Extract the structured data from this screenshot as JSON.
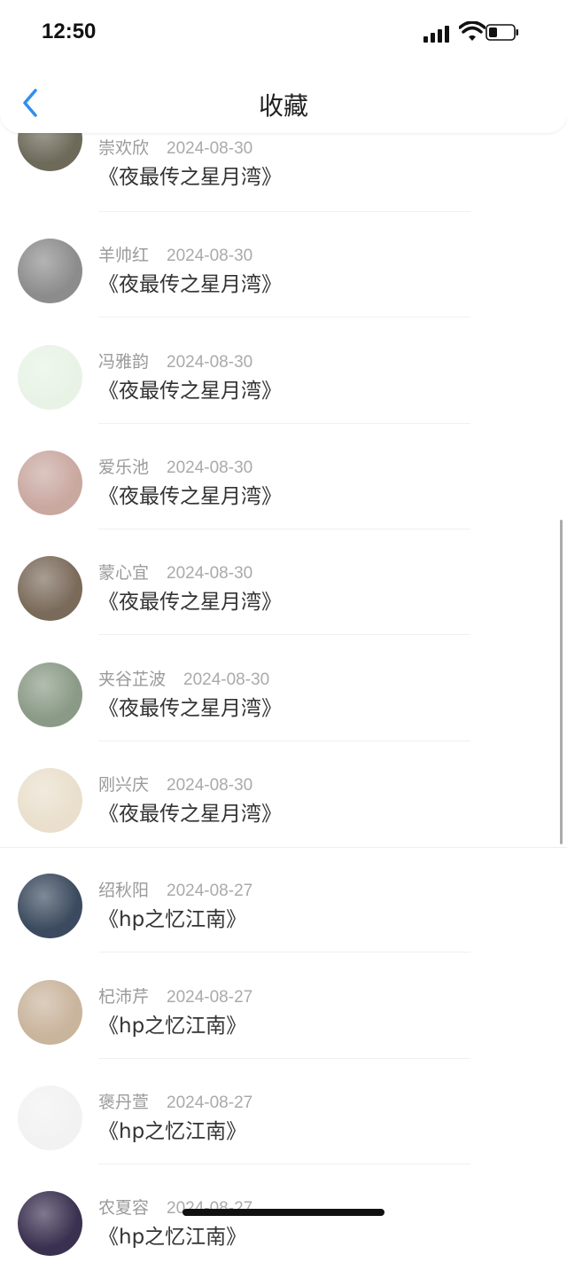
{
  "status_bar": {
    "time": "12:50"
  },
  "header": {
    "title": "收藏"
  },
  "items": [
    {
      "name": "崇欢欣",
      "date": "2024-08-30",
      "book": "《夜最传之星月湾》"
    },
    {
      "name": "羊帅红",
      "date": "2024-08-30",
      "book": "《夜最传之星月湾》"
    },
    {
      "name": "冯雅韵",
      "date": "2024-08-30",
      "book": "《夜最传之星月湾》"
    },
    {
      "name": "爱乐池",
      "date": "2024-08-30",
      "book": "《夜最传之星月湾》"
    },
    {
      "name": "蒙心宜",
      "date": "2024-08-30",
      "book": "《夜最传之星月湾》"
    },
    {
      "name": "夹谷芷波",
      "date": "2024-08-30",
      "book": "《夜最传之星月湾》"
    },
    {
      "name": "刚兴庆",
      "date": "2024-08-30",
      "book": "《夜最传之星月湾》"
    },
    {
      "name": "绍秋阳",
      "date": "2024-08-27",
      "book": "《hp之忆江南》"
    },
    {
      "name": "杞沛芹",
      "date": "2024-08-27",
      "book": "《hp之忆江南》"
    },
    {
      "name": "褒丹萱",
      "date": "2024-08-27",
      "book": "《hp之忆江南》"
    },
    {
      "name": "农夏容",
      "date": "2024-08-27",
      "book": "《hp之忆江南》"
    }
  ],
  "avatar_colors": [
    "#6e6a5a",
    "#8c8c8c",
    "#e8f3e6",
    "#c9a8a0",
    "#7a6a5a",
    "#8a9a86",
    "#e9dfcc",
    "#3b4a5e",
    "#c9b49c",
    "#f2f2f2",
    "#3a3050"
  ]
}
